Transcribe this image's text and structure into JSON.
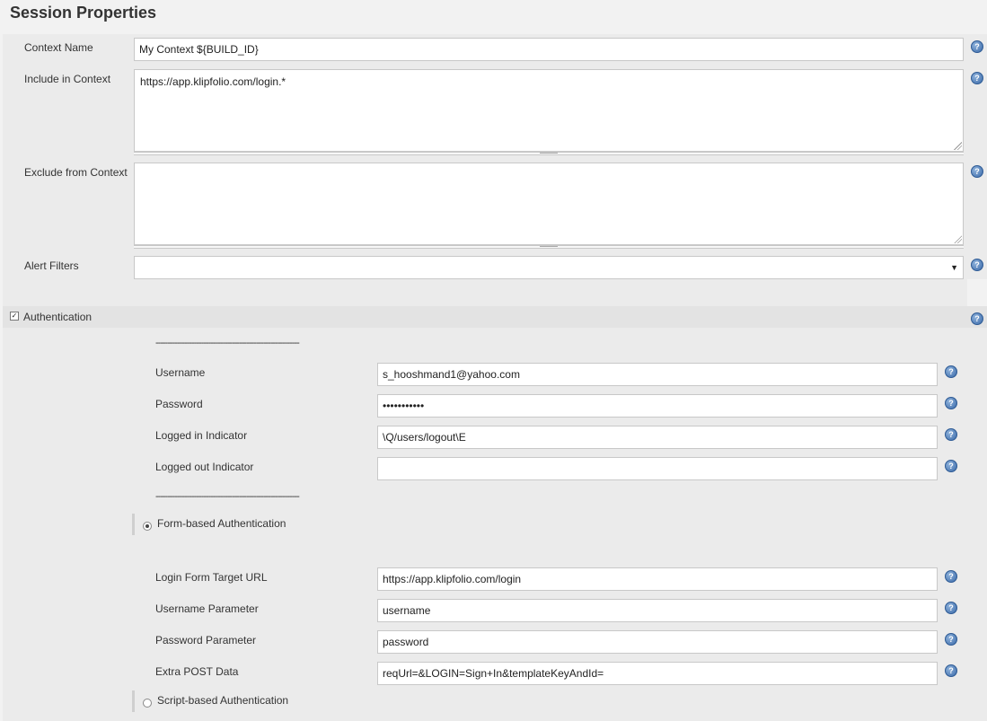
{
  "page": {
    "title": "Session Properties"
  },
  "context": {
    "name_label": "Context Name",
    "name_value": "My Context ${BUILD_ID}",
    "include_label": "Include in Context",
    "include_value": "https://app.klipfolio.com/login.*",
    "exclude_label": "Exclude from Context",
    "exclude_value": "",
    "alert_label": "Alert Filters",
    "alert_value": ""
  },
  "auth": {
    "section_label": "Authentication",
    "section_checked": true,
    "separator": "------------------------------------------------------------",
    "username_label": "Username",
    "username_value": "s_hooshmand1@yahoo.com",
    "password_label": "Password",
    "password_value": "•••••••••••",
    "logged_in_label": "Logged in Indicator",
    "logged_in_value": "\\Q/users/logout\\E",
    "logged_out_label": "Logged out Indicator",
    "logged_out_value": "",
    "form_radio_label": "Form-based Authentication",
    "form_selected": true,
    "target_url_label": "Login Form Target URL",
    "target_url_value": "https://app.klipfolio.com/login",
    "user_param_label": "Username Parameter",
    "user_param_value": "username",
    "pass_param_label": "Password Parameter",
    "pass_param_value": "password",
    "extra_post_label": "Extra POST Data",
    "extra_post_value": "reqUrl=&LOGIN=Sign+In&templateKeyAndId=",
    "script_radio_label": "Script-based Authentication"
  },
  "icons": {
    "help": "help-icon",
    "help_glyph": "?"
  }
}
